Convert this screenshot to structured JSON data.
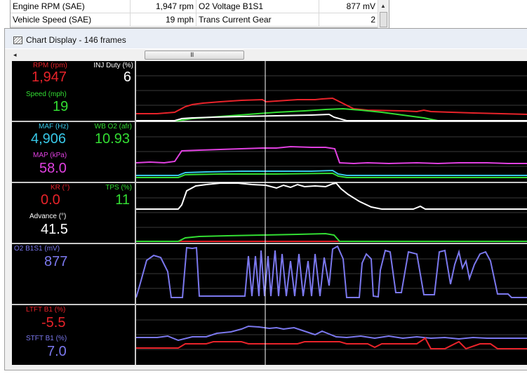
{
  "table": {
    "rows": [
      {
        "name1": "Engine RPM (SAE)",
        "value1": "1,947 rpm",
        "name2": "O2 Voltage B1S1",
        "value2": "877 mV"
      },
      {
        "name1": "Vehicle Speed (SAE)",
        "value1": "19 mph",
        "name2": "Trans Current Gear",
        "value2": "2"
      }
    ]
  },
  "window": {
    "title": "Chart Display  -  146 frames"
  },
  "hscroll": {
    "grip": "III"
  },
  "panels": [
    {
      "params": [
        {
          "label": "RPM (rpm)",
          "value": "1,947",
          "color": "#e8232a"
        },
        {
          "label": "INJ Duty (%)",
          "value": "6",
          "color": "#ffffff"
        },
        {
          "label": "Speed (mph)",
          "value": "19",
          "color": "#33dd33"
        }
      ]
    },
    {
      "params": [
        {
          "label": "MAF (Hz)",
          "value": "4,906",
          "color": "#38c8e8"
        },
        {
          "label": "WB O2 (afr)",
          "value": "10.93",
          "color": "#33dd33"
        },
        {
          "label": "MAP (kPa)",
          "value": "58.0",
          "color": "#e040e0"
        }
      ]
    },
    {
      "params": [
        {
          "label": "KR (°)",
          "value": "0.0",
          "color": "#e8232a"
        },
        {
          "label": "TPS (%)",
          "value": "11",
          "color": "#33dd33"
        },
        {
          "label": "Advance (°)",
          "value": "41.5",
          "color": "#ffffff"
        }
      ]
    },
    {
      "params": [
        {
          "label": "O2 B1S1 (mV)",
          "value": "877",
          "color": "#7b78ee"
        }
      ]
    },
    {
      "params": [
        {
          "label": "LTFT B1 (%)",
          "value": "-5.5",
          "color": "#e8232a"
        },
        {
          "label": "STFT B1 (%)",
          "value": "7.0",
          "color": "#7b78ee"
        }
      ]
    }
  ],
  "colors": {
    "red": "#e8232a",
    "green": "#33dd33",
    "white": "#ffffff",
    "cyan": "#38c8e8",
    "magenta": "#e040e0",
    "blue": "#7b78ee",
    "grid": "#3a3a3a"
  },
  "icons": {
    "title": "chart-window-icon",
    "scroll_up": "arrow-up-icon",
    "scroll_left": "arrow-left-icon"
  }
}
